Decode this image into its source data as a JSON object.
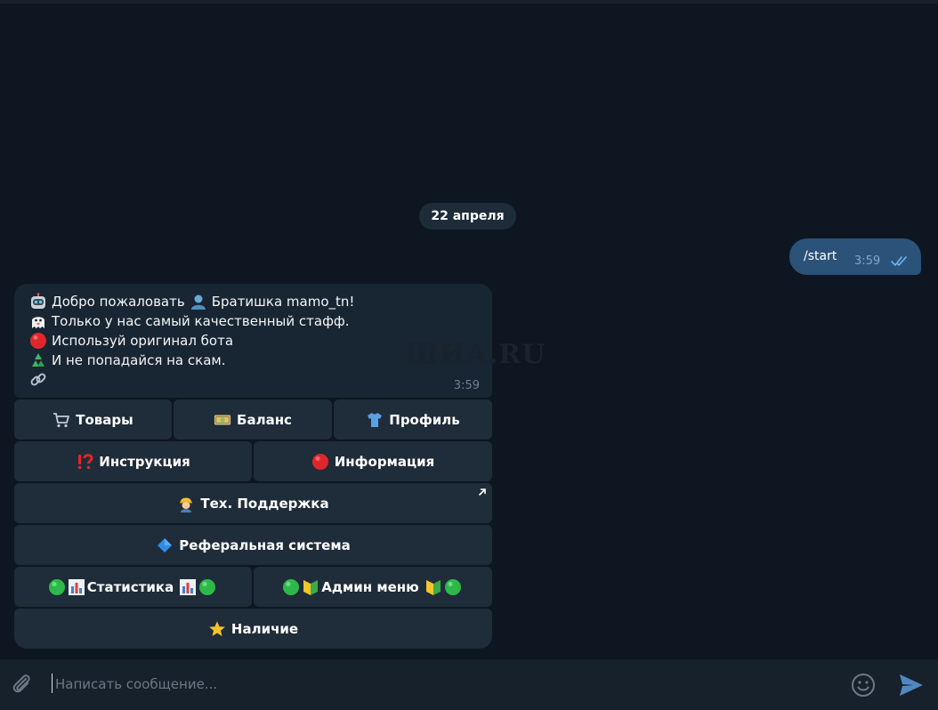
{
  "chat": {
    "date_separator": "22 апреля",
    "outgoing": {
      "text": "/start",
      "time": "3:59",
      "status_icon": "double-check-icon"
    },
    "incoming": {
      "lines": [
        {
          "icon": "robot-face",
          "text": "Добро пожаловать",
          "inline_icon": "bust-silhouette",
          "text_after": "Братишка mamo_tn!"
        },
        {
          "icon": "ghost",
          "text": "Только у нас самый качественный стафф."
        },
        {
          "icon": "red-circle",
          "text": "Используй оригинал бота"
        },
        {
          "icon": "recycle-symbol",
          "text": "И не попадайся на скам."
        },
        {
          "icon": "link-symbol",
          "text": ""
        }
      ],
      "time": "3:59"
    },
    "watermark": "ШИА.RU"
  },
  "keyboard": {
    "goods": {
      "label": "Товары",
      "icon": "shopping-cart"
    },
    "balance": {
      "label": "Баланс",
      "icon": "money-banknote"
    },
    "profile": {
      "label": "Профиль",
      "icon": "t-shirt"
    },
    "instructions": {
      "label": "Инструкция",
      "icon": "exclamation-question-mark"
    },
    "information": {
      "label": "Информация",
      "icon": "red-circle"
    },
    "support": {
      "label": "Тех. Поддержка",
      "icon": "technician",
      "link_icon": "external-link-arrow"
    },
    "referral": {
      "label": "Реферальная система",
      "icon": "blue-diamond"
    },
    "statistics": {
      "label": "Статистика",
      "icon": "green-circle-bar-chart"
    },
    "admin": {
      "label": "Админ меню",
      "icon": "green-circle-beginner-badge"
    },
    "availability": {
      "label": "Наличие",
      "icon": "star"
    }
  },
  "composer": {
    "placeholder": "Написать сообщение..."
  },
  "colors": {
    "background": "#0e1621",
    "bubble_in": "#182533",
    "bubble_out": "#2b5278",
    "keyboard_button": "#1f2c3a",
    "composer": "#17212b",
    "accent": "#5288c1"
  }
}
